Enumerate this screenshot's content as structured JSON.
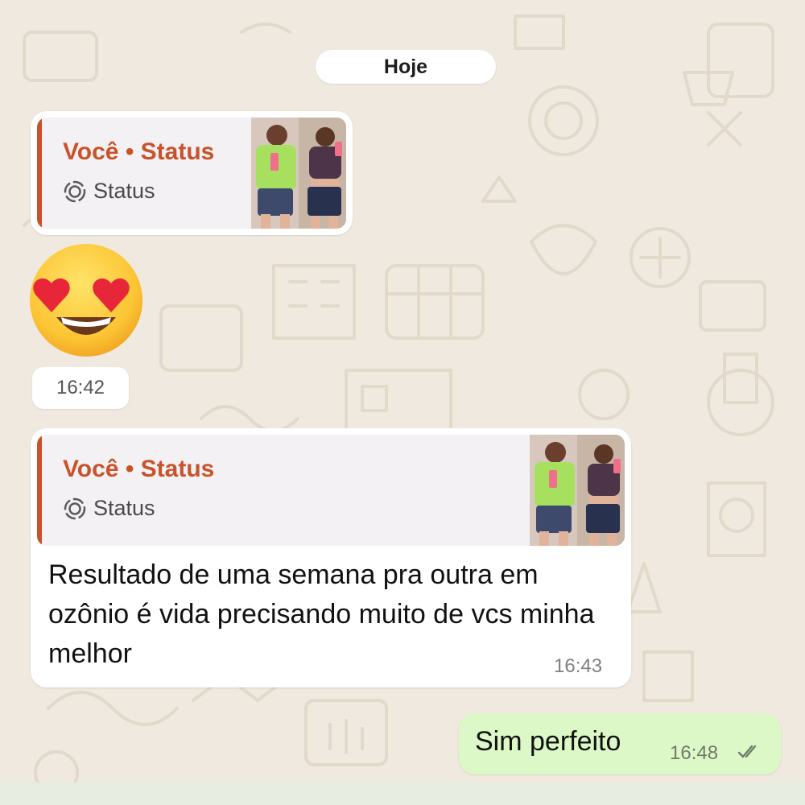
{
  "chat": {
    "date_separator": "Hoje",
    "messages": [
      {
        "reply": {
          "author": "Você • Status",
          "type_label": "Status",
          "icon": "status-ring-icon"
        },
        "emoji": "smiling-face-with-heart-eyes",
        "time": "16:42"
      },
      {
        "reply": {
          "author": "Você • Status",
          "type_label": "Status",
          "icon": "status-ring-icon"
        },
        "text": "Resultado de uma semana pra outra em ozônio é vida  precisando muito de vcs minha melhor",
        "time": "16:43"
      },
      {
        "text": "Sim perfeito",
        "time": "16:48",
        "read_receipt_icon": "double-check-icon"
      }
    ]
  },
  "colors": {
    "reply_accent": "#c8532a",
    "outgoing_bubble": "#dcf8c6",
    "incoming_bubble": "#ffffff",
    "wallpaper": "#efe9e0"
  }
}
